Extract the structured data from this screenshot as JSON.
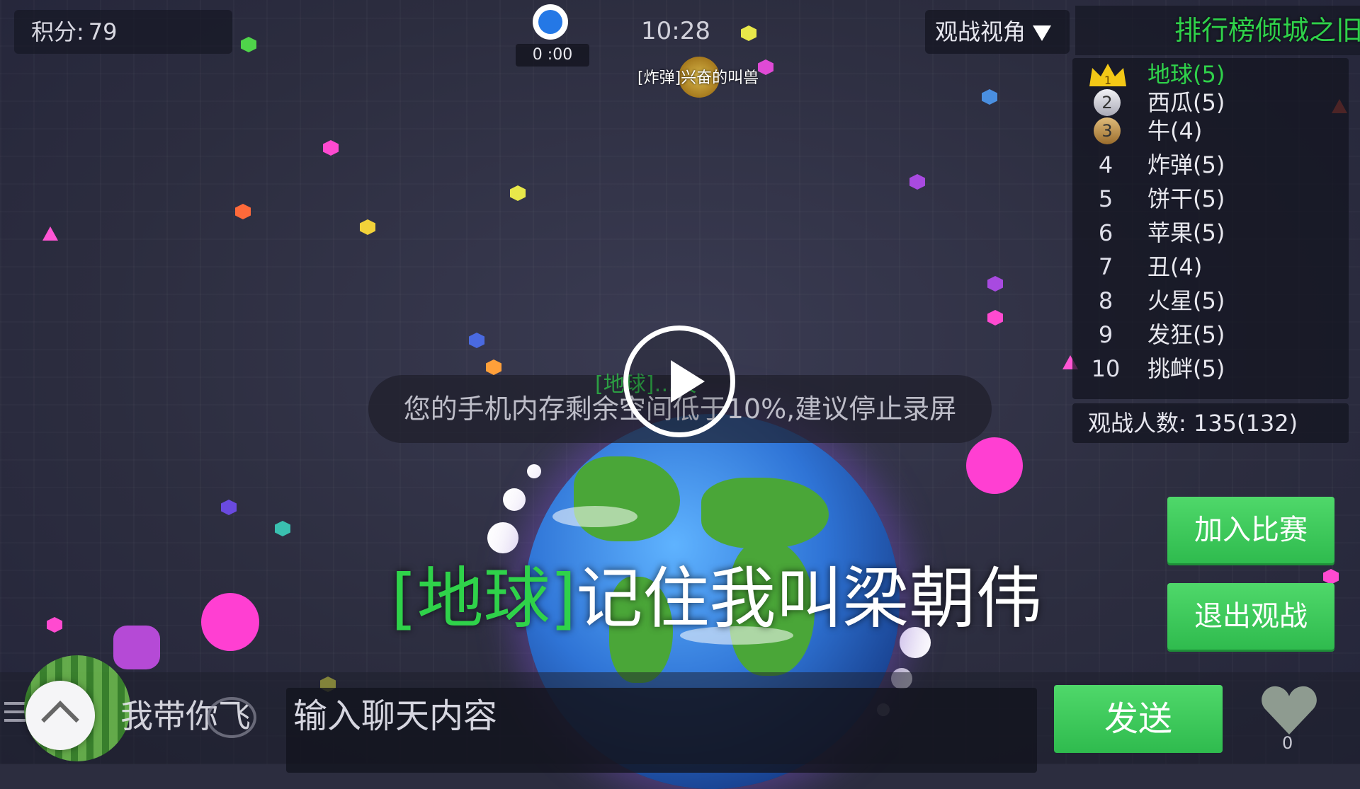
{
  "hud": {
    "score_label": "积分:",
    "score_value": "79",
    "countdown": "0 :00",
    "clock": "10:28",
    "spectate_label": "观战视角"
  },
  "map": {
    "bomb_cell_label": "[炸弹]兴奋的叫兽"
  },
  "leaderboard": {
    "header": "排行榜倾城之旧",
    "rows": [
      {
        "rank": "1",
        "name": "地球(5)"
      },
      {
        "rank": "2",
        "name": "西瓜(5)"
      },
      {
        "rank": "3",
        "name": "牛(4)"
      },
      {
        "rank": "4",
        "name": "炸弹(5)"
      },
      {
        "rank": "5",
        "name": "饼干(5)"
      },
      {
        "rank": "6",
        "name": "苹果(5)"
      },
      {
        "rank": "7",
        "name": "丑(4)"
      },
      {
        "rank": "8",
        "name": "火星(5)"
      },
      {
        "rank": "9",
        "name": "发狂(5)"
      },
      {
        "rank": "10",
        "name": "挑衅(5)"
      }
    ],
    "spectators": "观战人数: 135(132)"
  },
  "buttons": {
    "join": "加入比赛",
    "exit": "退出观战",
    "send": "发送"
  },
  "notice": {
    "toast": "您的手机内存剩余空间低于10%,建议停止录屏",
    "peek": "[地球]…天"
  },
  "chat": {
    "tag": "[地球]",
    "message": "记住我叫梁朝伟",
    "input_placeholder": "输入聊天内容",
    "quick_phrase": "我带你飞"
  },
  "likes": "0",
  "colors": {
    "accent_green": "#2fd24a",
    "button_green": "#3fca5c",
    "pink_blob": "#ff3fd2"
  },
  "icons": [
    "timer-icon",
    "chevron-down-icon",
    "crown-icon",
    "play-icon",
    "chevron-up-icon",
    "chat-bubble-icon",
    "heart-icon",
    "menu-icon"
  ]
}
